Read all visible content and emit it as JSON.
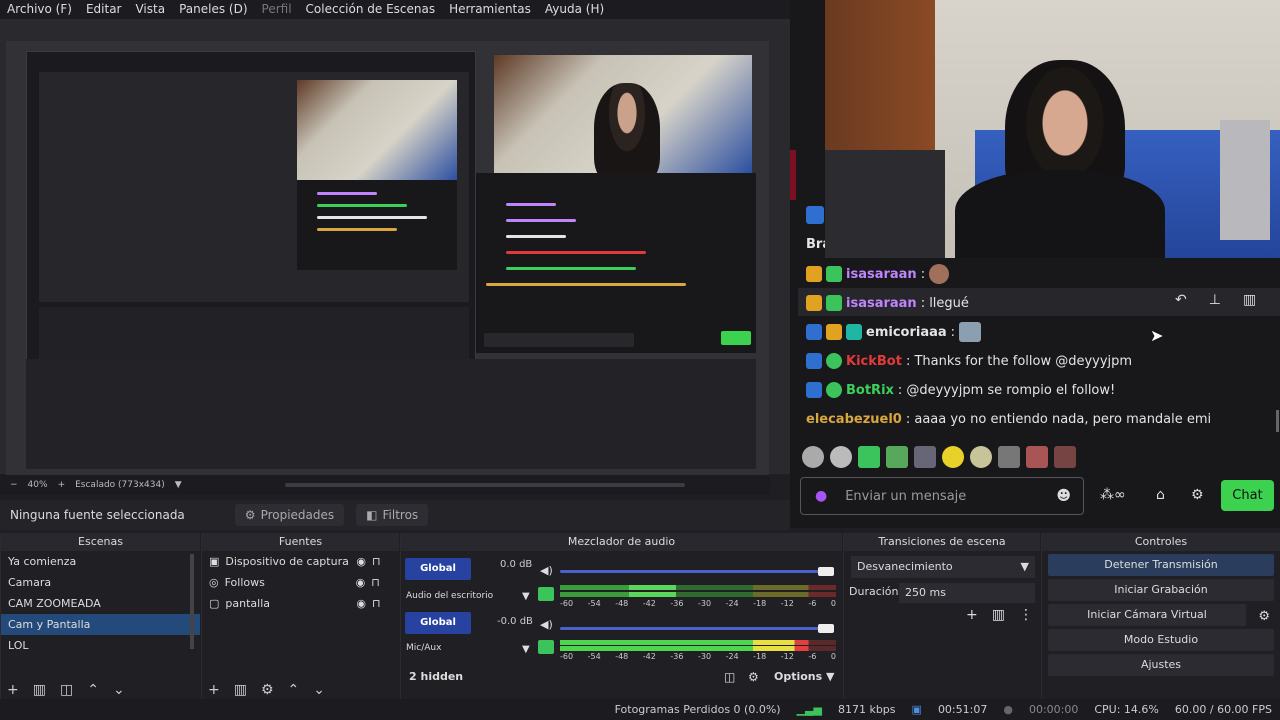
{
  "menubar": {
    "items": [
      "Archivo (F)",
      "Editar",
      "Vista",
      "Paneles (D)",
      "Perfil",
      "Colección de Escenas",
      "Herramientas",
      "Ayuda (H)"
    ]
  },
  "preview": {
    "zoom": "40%",
    "scaled": "Escalado (773x434)"
  },
  "properties_bar": {
    "no_source": "Ninguna fuente seleccionada",
    "properties": "Propiedades",
    "filters": "Filtros"
  },
  "chat": {
    "header_fragment": "Bra",
    "messages": [
      {
        "user": "isasaraan",
        "text": ":",
        "user_color": "#c084fc"
      },
      {
        "user": "isasaraan",
        "text": ": llegué",
        "user_color": "#c084fc"
      },
      {
        "user": "emicoriaaa",
        "text": ":",
        "user_color": "#e4e4e7"
      },
      {
        "user": "KickBot",
        "text": ": Thanks for the follow @deyyyjpm",
        "user_color": "#e23a3a"
      },
      {
        "user": "BotRix",
        "text": ": @deyyyjpm se rompio el follow!",
        "user_color": "#3ccf5a"
      },
      {
        "user": "elecabezuel0",
        "text": ": aaaa yo no entiendo nada, pero mandale emi",
        "user_color": "#d9a640"
      }
    ],
    "input_placeholder": "Enviar un mensaje",
    "send_label": "Chat",
    "accent": "#3cd24f"
  },
  "scenes": {
    "title": "Escenas",
    "items": [
      "Ya comienza",
      "Camara",
      "CAM ZOOMEADA",
      "Cam y Pantalla",
      "LOL"
    ],
    "selected_index": 3
  },
  "sources": {
    "title": "Fuentes",
    "items": [
      "Dispositivo de captura de v",
      "Follows",
      "pantalla"
    ]
  },
  "mixer": {
    "title": "Mezclador de audio",
    "channels": [
      {
        "name": "Audio del escritorio",
        "db": "0.0 dB",
        "button": "Global"
      },
      {
        "name": "Mic/Aux",
        "db": "-0.0 dB",
        "button": "Global"
      }
    ],
    "scale": [
      "-60",
      "-54",
      "-48",
      "-42",
      "-36",
      "-30",
      "-24",
      "-18",
      "-12",
      "-6",
      "0"
    ],
    "hidden": "2 hidden",
    "options": "Options"
  },
  "transitions": {
    "title": "Transiciones de escena",
    "selected": "Desvanecimiento",
    "duration_label": "Duración",
    "duration_value": "250 ms"
  },
  "controls": {
    "title": "Controles",
    "buttons": [
      "Detener Transmisión",
      "Iniciar Grabación",
      "Iniciar Cámara Virtual",
      "Modo Estudio",
      "Ajustes"
    ]
  },
  "status": {
    "dropped_frames": "Fotogramas Perdidos 0 (0.0%)",
    "bitrate": "8171 kbps",
    "live_time": "00:51:07",
    "rec_time": "00:00:00",
    "cpu": "CPU: 14.6%",
    "fps": "60.00 / 60.00 FPS"
  }
}
